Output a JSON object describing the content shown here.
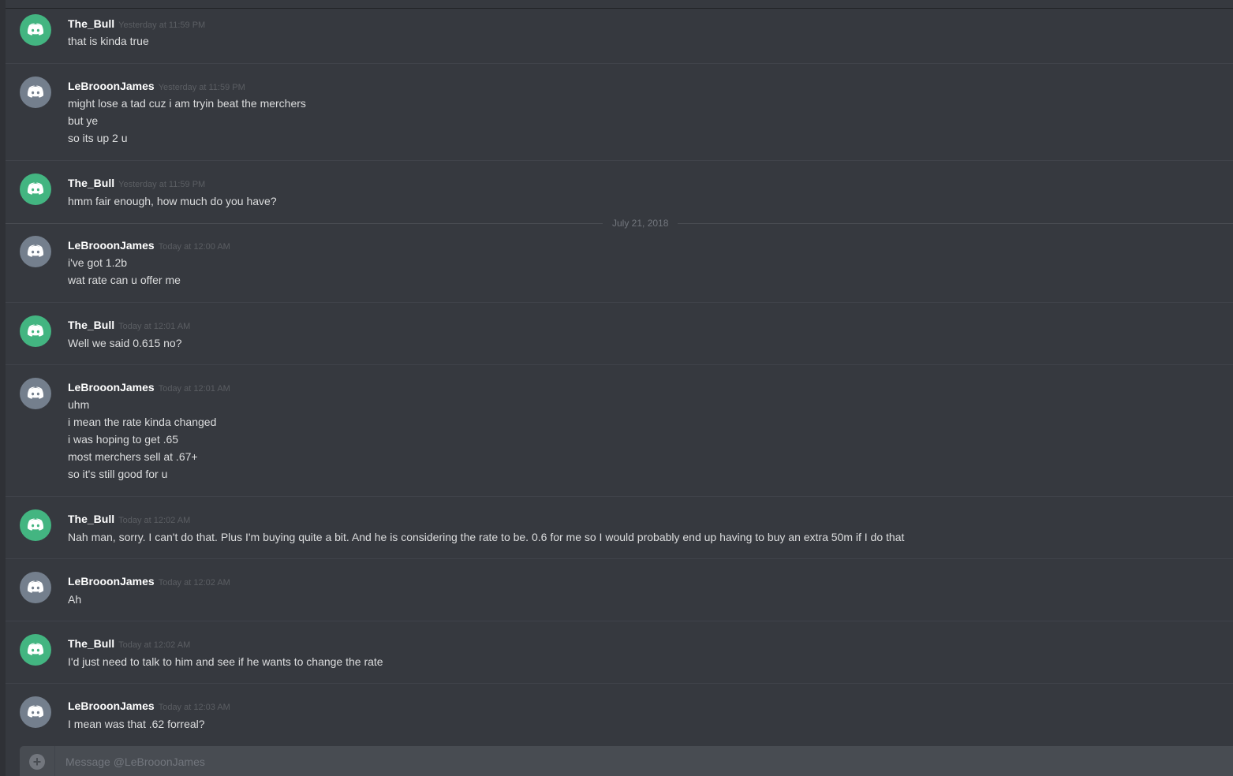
{
  "colors": {
    "background": "#36393f",
    "avatar_green": "#43b581",
    "avatar_grey": "#747f8d",
    "username": "#ffffff",
    "message_text": "#dcddde",
    "timestamp": "#5b5e63"
  },
  "date_divider": "July 21, 2018",
  "messages": [
    {
      "author": "The_Bull",
      "avatar_icon": "discord-logo-icon",
      "timestamp": "Yesterday at 11:59 PM",
      "lines": [
        "that is kinda true"
      ]
    },
    {
      "author": "LeBrooonJames",
      "avatar_icon": "discord-logo-icon",
      "timestamp": "Yesterday at 11:59 PM",
      "lines": [
        "might lose a tad cuz i am tryin beat the merchers",
        "but ye",
        "so its up 2 u"
      ]
    },
    {
      "author": "The_Bull",
      "avatar_icon": "discord-logo-icon",
      "timestamp": "Yesterday at 11:59 PM",
      "lines": [
        "hmm fair enough, how much do you have?"
      ]
    },
    {
      "author": "LeBrooonJames",
      "avatar_icon": "discord-logo-icon",
      "timestamp": "Today at 12:00 AM",
      "lines": [
        "i've got 1.2b",
        "wat rate can u offer me"
      ]
    },
    {
      "author": "The_Bull",
      "avatar_icon": "discord-logo-icon",
      "timestamp": "Today at 12:01 AM",
      "lines": [
        "Well we said 0.615 no?"
      ]
    },
    {
      "author": "LeBrooonJames",
      "avatar_icon": "discord-logo-icon",
      "timestamp": "Today at 12:01 AM",
      "lines": [
        "uhm",
        "i mean the rate kinda changed",
        "i was hoping to get .65",
        "most merchers sell at .67+",
        "so it's still good for u"
      ]
    },
    {
      "author": "The_Bull",
      "avatar_icon": "discord-logo-icon",
      "timestamp": "Today at 12:02 AM",
      "lines": [
        "Nah man, sorry. I can't do that. Plus I'm buying quite a bit. And he is considering the rate to be. 0.6 for me so I would probably end up having to buy an extra 50m if I do that"
      ]
    },
    {
      "author": "LeBrooonJames",
      "avatar_icon": "discord-logo-icon",
      "timestamp": "Today at 12:02 AM",
      "lines": [
        "Ah"
      ]
    },
    {
      "author": "The_Bull",
      "avatar_icon": "discord-logo-icon",
      "timestamp": "Today at 12:02 AM",
      "lines": [
        "I'd just need to talk to him and see if he wants to change the rate"
      ]
    },
    {
      "author": "LeBrooonJames",
      "avatar_icon": "discord-logo-icon",
      "timestamp": "Today at 12:03 AM",
      "lines": [
        "I mean was that .62 forreal?"
      ]
    }
  ],
  "composer": {
    "placeholder": "Message @LeBrooonJames",
    "add_icon": "plus-circle-icon"
  }
}
